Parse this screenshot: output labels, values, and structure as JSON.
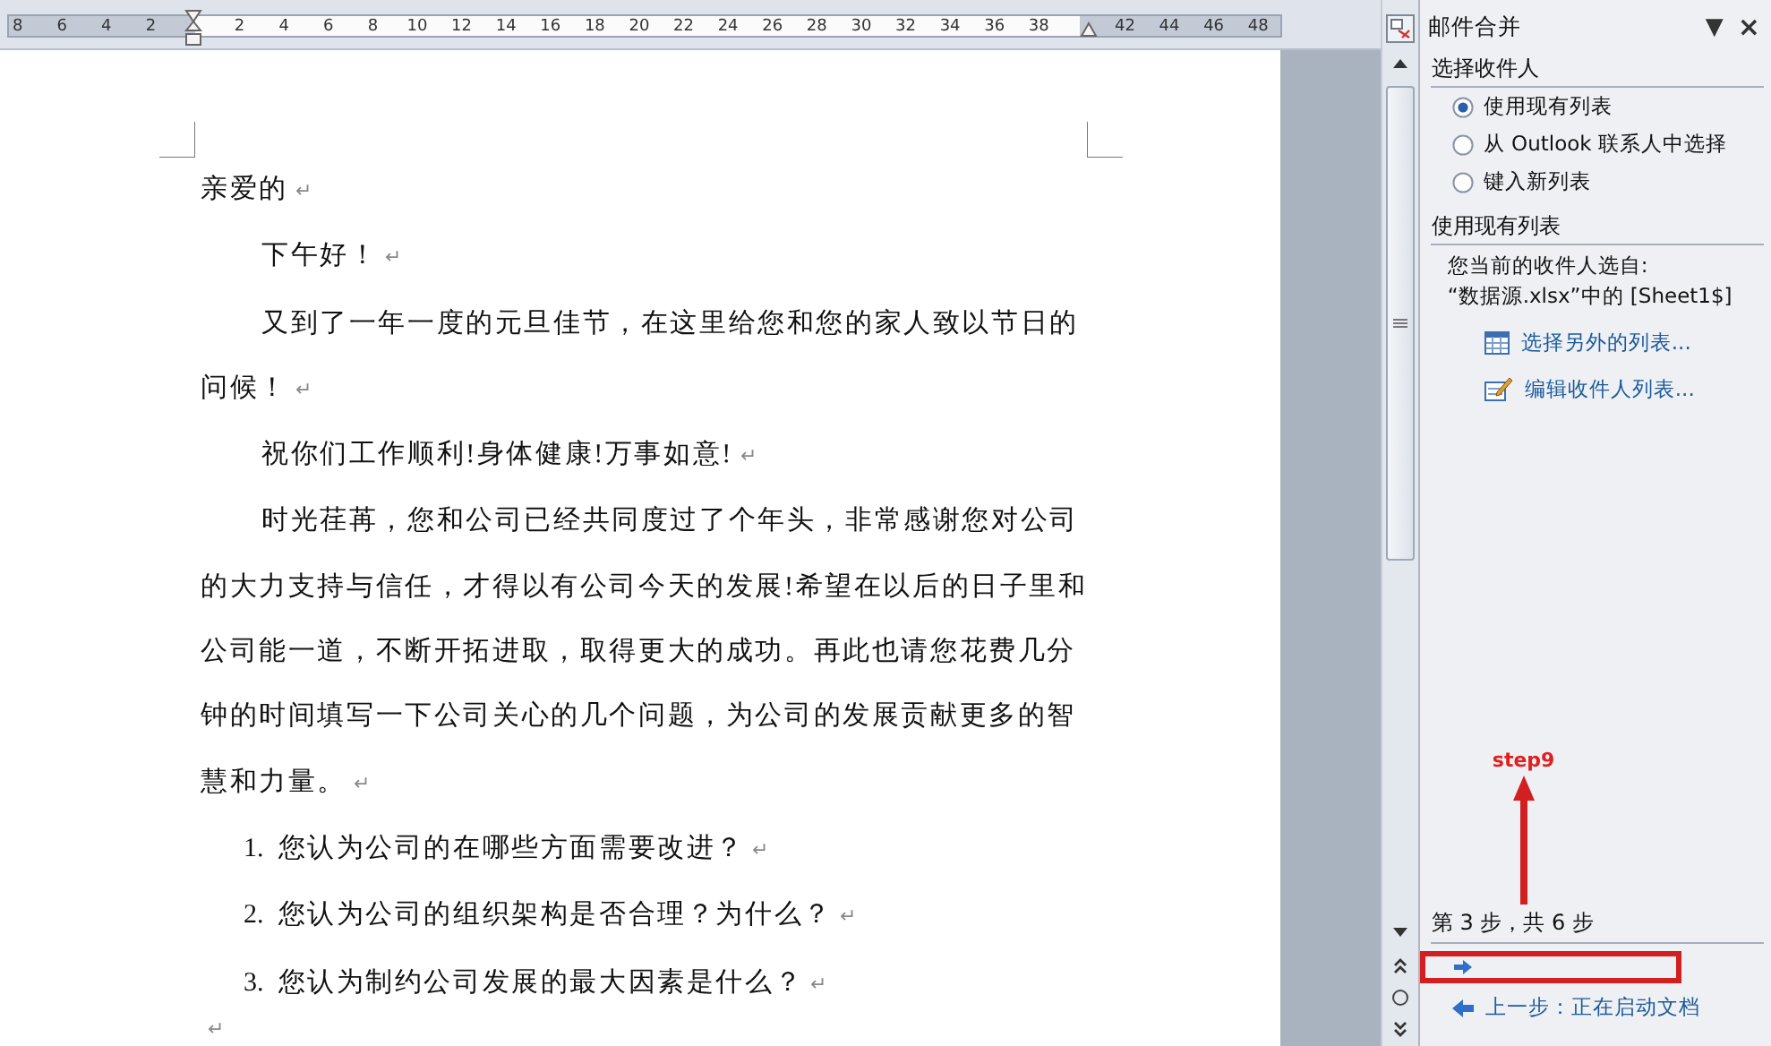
{
  "ruler": {
    "left_labels": [
      "8",
      "6",
      "4",
      "2"
    ],
    "body_labels": [
      "2",
      "4",
      "6",
      "8",
      "10",
      "12",
      "14",
      "16",
      "18",
      "20",
      "22",
      "24",
      "26",
      "28",
      "30",
      "32",
      "34",
      "36",
      "38"
    ],
    "right_labels": [
      "42",
      "44",
      "46",
      "48"
    ]
  },
  "document": {
    "paragraphs": [
      {
        "kind": "plain",
        "text": "亲爱的",
        "mark": "↵"
      },
      {
        "kind": "indent",
        "text": "下午好！",
        "mark": "↵"
      },
      {
        "kind": "indent",
        "text": "又到了一年一度的元旦佳节，在这里给您和您的家人致以节日的问候！",
        "mark": "↵"
      },
      {
        "kind": "indent",
        "text": "祝你们工作顺利!身体健康!万事如意!",
        "mark": "↵"
      },
      {
        "kind": "indent",
        "text": "时光荏苒，您和公司已经共同度过了个年头，非常感谢您对公司的大力支持与信任，才得以有公司今天的发展!希望在以后的日子里和公司能一道，不断开拓进取，取得更大的成功。再此也请您花费几分钟的时间填写一下公司关心的几个问题，为公司的发展贡献更多的智慧和力量。",
        "mark": "↵"
      },
      {
        "kind": "numbered",
        "number": "1.",
        "text": "您认为公司的在哪些方面需要改进？",
        "mark": "↵"
      },
      {
        "kind": "numbered",
        "number": "2.",
        "text": "您认为公司的组织架构是否合理？为什么？",
        "mark": "↵"
      },
      {
        "kind": "numbered",
        "number": "3.",
        "text": "您认为制约公司发展的最大因素是什么？",
        "mark": "↵"
      },
      {
        "kind": "empty",
        "mark": "↵"
      }
    ]
  },
  "task_pane": {
    "title": "邮件合并",
    "menu_glyph": "▼",
    "close_glyph": "×",
    "recipients": {
      "heading": "选择收件人",
      "options": [
        {
          "label": "使用现有列表",
          "selected": true
        },
        {
          "label": "从 Outlook 联系人中选择",
          "selected": false
        },
        {
          "label": "键入新列表",
          "selected": false
        }
      ]
    },
    "existing_list": {
      "heading": "使用现有列表",
      "lines": [
        "您当前的收件人选自:",
        "“数据源.xlsx”中的 [Sheet1$]"
      ],
      "links": [
        {
          "kind": "table",
          "label": "选择另外的列表..."
        },
        {
          "kind": "edit",
          "label": "编辑收件人列表..."
        }
      ]
    },
    "step": "第 3 步，共 6 步",
    "previous_link": "上一步：正在启动文档"
  },
  "annotation": {
    "label": "step9"
  }
}
